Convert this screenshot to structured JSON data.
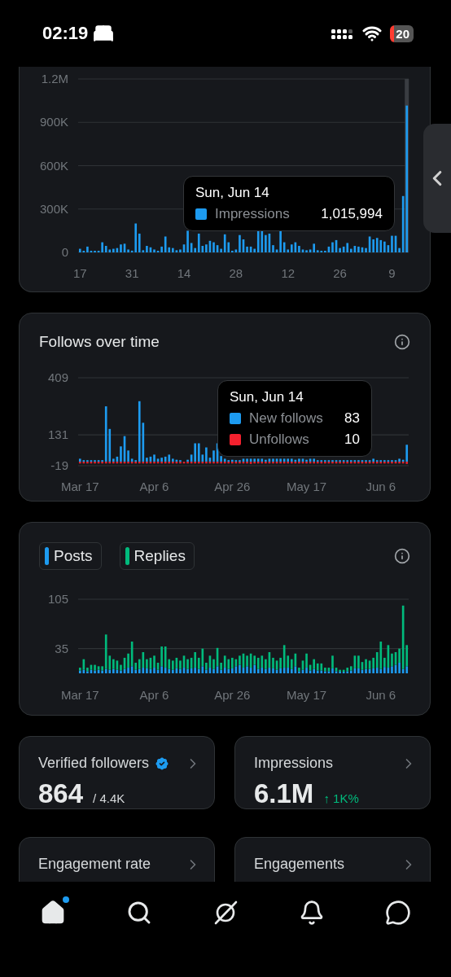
{
  "status_bar": {
    "time": "02:19",
    "battery": "20"
  },
  "impressions_chart": {
    "axis_labels": [
      "17",
      "31",
      "14",
      "28",
      "12",
      "26",
      "9"
    ],
    "chart_data": {
      "type": "bar",
      "grid": true,
      "ylim": [
        0,
        1200000
      ],
      "yticks": [
        {
          "value": 0,
          "label": "0"
        },
        {
          "value": 300000,
          "label": "300K"
        },
        {
          "value": 600000,
          "label": "600K"
        },
        {
          "value": 900000,
          "label": "900K"
        },
        {
          "value": 1200000,
          "label": "1.2M"
        }
      ],
      "series": [
        {
          "name": "Impressions",
          "color": "#1d9bf0",
          "values": [
            25000,
            10000,
            40000,
            8000,
            8000,
            8000,
            70000,
            45000,
            20000,
            25000,
            30000,
            55000,
            60000,
            20000,
            12000,
            200000,
            130000,
            15000,
            45000,
            35000,
            20000,
            10000,
            40000,
            110000,
            35000,
            30000,
            15000,
            20000,
            55000,
            150000,
            65000,
            30000,
            130000,
            45000,
            55000,
            80000,
            70000,
            50000,
            25000,
            125000,
            70000,
            10000,
            20000,
            120000,
            90000,
            40000,
            40000,
            25000,
            150000,
            150000,
            120000,
            130000,
            50000,
            20000,
            150000,
            70000,
            20000,
            55000,
            70000,
            45000,
            20000,
            15000,
            20000,
            60000,
            15000,
            10000,
            10000,
            40000,
            70000,
            85000,
            30000,
            40000,
            65000,
            25000,
            45000,
            40000,
            35000,
            30000,
            110000,
            90000,
            100000,
            85000,
            75000,
            50000,
            115000,
            115000,
            30000,
            390000,
            1015994
          ]
        }
      ]
    },
    "tooltip": {
      "title": "Sun, Jun 14",
      "values": [
        "1,015,994"
      ]
    }
  },
  "follows_chart": {
    "title": "Follows over time",
    "axis_labels": [
      "Mar 17",
      "Apr 6",
      "Apr 26",
      "May 17",
      "Jun 6"
    ],
    "chart_data": {
      "type": "bar",
      "grid": true,
      "stacked": true,
      "ylim": [
        -19,
        409
      ],
      "yticks": [
        -19,
        131,
        409
      ],
      "series": [
        {
          "name": "New follows",
          "color": "#1d9bf0",
          "values": [
            15,
            5,
            3,
            3,
            5,
            8,
            8,
            270,
            160,
            15,
            25,
            75,
            125,
            55,
            15,
            5,
            295,
            190,
            20,
            25,
            35,
            15,
            20,
            25,
            35,
            15,
            10,
            5,
            0,
            10,
            35,
            90,
            90,
            35,
            70,
            20,
            55,
            90,
            28,
            15,
            8,
            10,
            8,
            5,
            15,
            15,
            15,
            15,
            15,
            15,
            10,
            15,
            15,
            15,
            15,
            15,
            15,
            15,
            10,
            15,
            15,
            10,
            15,
            15,
            5,
            5,
            3,
            3,
            3,
            3,
            3,
            5,
            5,
            3,
            3,
            3,
            3,
            3,
            3,
            15,
            3,
            3,
            3,
            3,
            3,
            3,
            15,
            10,
            83
          ]
        },
        {
          "name": "Unfollows",
          "color": "#f4212e",
          "values": [
            -3,
            -2,
            -3,
            -2,
            -3,
            -3,
            -5,
            -3,
            -3,
            -2,
            -3,
            -3,
            -5,
            -3,
            -6,
            -3,
            -5,
            -3,
            -2,
            -3,
            -3,
            -2,
            -3,
            -3,
            -3,
            -5,
            -3,
            -3,
            -3,
            -6,
            -3,
            -3,
            -3,
            -3,
            -5,
            -3,
            -3,
            -3,
            -3,
            -5,
            -3,
            -3,
            -3,
            -3,
            -3,
            -3,
            -10,
            -3,
            -3,
            -3,
            -3,
            -5,
            -3,
            -3,
            -3,
            -3,
            -3,
            -6,
            -3,
            -3,
            -3,
            -3,
            -3,
            -5,
            -3,
            -3,
            -3,
            -3,
            -5,
            -3,
            -3,
            -3,
            -3,
            -3,
            -5,
            -3,
            -3,
            -3,
            -3,
            -3,
            -3,
            -5,
            -3,
            -3,
            -3,
            -5,
            -3,
            -3,
            -10
          ]
        }
      ]
    },
    "tooltip": {
      "title": "Sun, Jun 14",
      "values": [
        "83",
        "10"
      ]
    }
  },
  "activity_chart": {
    "axis_labels": [
      "Mar 17",
      "Apr 6",
      "Apr 26",
      "May 17",
      "Jun 6"
    ],
    "chart_data": {
      "type": "bar",
      "grid": true,
      "stacked": true,
      "ylim": [
        0,
        105
      ],
      "yticks": [
        35,
        105
      ],
      "series": [
        {
          "name": "Posts",
          "color": "#1d9bf0",
          "values": [
            4,
            5,
            3,
            5,
            4,
            5,
            4,
            6,
            5,
            6,
            5,
            4,
            6,
            8,
            10,
            5,
            6,
            8,
            7,
            6,
            8,
            5,
            10,
            8,
            6,
            5,
            7,
            6,
            8,
            6,
            7,
            8,
            6,
            10,
            5,
            8,
            6,
            10,
            5,
            8,
            6,
            7,
            10,
            12,
            8,
            10,
            8,
            12,
            6,
            8,
            6,
            8,
            7,
            5,
            7,
            8,
            8,
            6,
            10,
            3,
            5,
            8,
            4,
            6,
            4,
            4,
            3,
            3,
            7,
            3,
            2,
            2,
            3,
            4,
            7,
            7,
            5,
            6,
            6,
            7,
            8,
            6,
            9,
            8,
            10,
            12,
            15,
            6,
            10
          ]
        },
        {
          "name": "Replies",
          "color": "#00ba7c",
          "values": [
            4,
            15,
            5,
            7,
            8,
            5,
            6,
            49,
            20,
            14,
            13,
            8,
            16,
            20,
            35,
            10,
            14,
            22,
            13,
            16,
            17,
            10,
            28,
            30,
            14,
            13,
            15,
            12,
            17,
            14,
            15,
            22,
            16,
            25,
            10,
            17,
            14,
            26,
            10,
            17,
            14,
            15,
            10,
            13,
            20,
            15,
            20,
            13,
            16,
            17,
            14,
            22,
            15,
            13,
            15,
            32,
            17,
            14,
            18,
            5,
            13,
            20,
            8,
            14,
            10,
            10,
            5,
            5,
            18,
            5,
            3,
            3,
            5,
            6,
            18,
            18,
            11,
            14,
            12,
            15,
            22,
            39,
            13,
            32,
            18,
            18,
            20,
            90,
            30
          ]
        }
      ]
    }
  },
  "stat_cards": [
    {
      "title": "Verified followers",
      "verified": true,
      "value": "864",
      "total": "/ 4.4K"
    },
    {
      "title": "Impressions",
      "verified": false,
      "value": "6.1M",
      "change": "↑ 1K%"
    },
    {
      "title": "Engagement rate",
      "verified": false
    },
    {
      "title": "Engagements",
      "verified": false
    }
  ],
  "nav": [
    {
      "kind": "home",
      "selected": true,
      "badge": true
    },
    {
      "kind": "search",
      "selected": false,
      "badge": false
    },
    {
      "kind": "grok",
      "selected": false,
      "badge": false
    },
    {
      "kind": "bell",
      "selected": false,
      "badge": false
    },
    {
      "kind": "messages",
      "selected": false,
      "badge": false
    }
  ]
}
